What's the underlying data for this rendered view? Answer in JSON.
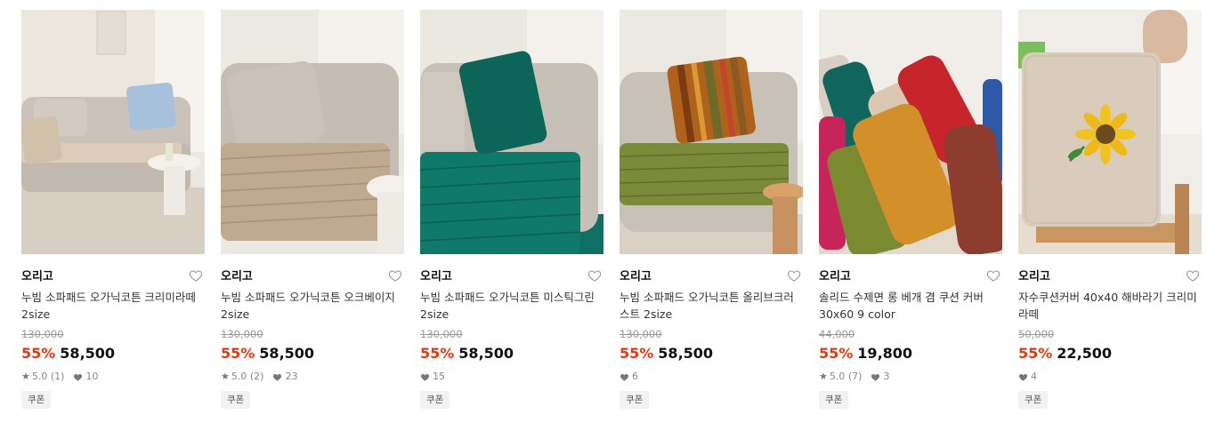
{
  "products": [
    {
      "brand": "오리고",
      "title": "누빔 소파패드 오가닉코튼 크리미라떼 2size",
      "original_price": "130,000",
      "discount_rate": "55%",
      "sale_price": "58,500",
      "rating": "5.0",
      "review_count": "(1)",
      "likes": "10",
      "coupon_label": "쿠폰",
      "thumb_colors": {
        "bg": "#e9e3da",
        "sofa": "#cfc7bd",
        "pad": "#d9c8b2",
        "pillow": "#a9c3dc"
      }
    },
    {
      "brand": "오리고",
      "title": "누빔 소파패드 오가닉코튼 오크베이지 2size",
      "original_price": "130,000",
      "discount_rate": "55%",
      "sale_price": "58,500",
      "rating": "5.0",
      "review_count": "(2)",
      "likes": "23",
      "coupon_label": "쿠폰",
      "thumb_colors": {
        "bg": "#ece8e2",
        "sofa": "#c9c0b5",
        "pad": "#bfa991",
        "pillow": "#cbbfb2"
      }
    },
    {
      "brand": "오리고",
      "title": "누빔 소파패드 오가닉코튼 미스틱그린 2size",
      "original_price": "130,000",
      "discount_rate": "55%",
      "sale_price": "58,500",
      "rating": "",
      "review_count": "",
      "likes": "15",
      "coupon_label": "쿠폰",
      "thumb_colors": {
        "bg": "#ebe7e1",
        "sofa": "#c8c1b8",
        "pad": "#0f7a6a",
        "pillow": "#0d6559"
      }
    },
    {
      "brand": "오리고",
      "title": "누빔 소파패드 오가닉코튼 올리브크러스트 2size",
      "original_price": "130,000",
      "discount_rate": "55%",
      "sale_price": "58,500",
      "rating": "",
      "review_count": "",
      "likes": "6",
      "coupon_label": "쿠폰",
      "thumb_colors": {
        "bg": "#ece8e2",
        "sofa": "#c9c2b9",
        "pad": "#7b8b3a",
        "pillow": "#b66a1e"
      }
    },
    {
      "brand": "오리고",
      "title": "솔리드 수제면 롱 베개 겸 쿠션 커버 30x60 9 color",
      "original_price": "44,000",
      "discount_rate": "55%",
      "sale_price": "19,800",
      "rating": "5.0",
      "review_count": "(7)",
      "likes": "3",
      "coupon_label": "쿠폰",
      "thumb_colors": {
        "bg": "#f1ede8",
        "sofa": "#d9cfc4",
        "pad": "#d8962a",
        "pillow": "#c42a2a"
      }
    },
    {
      "brand": "오리고",
      "title": "자수쿠션커버 40x40 해바라기 크리미라떼",
      "original_price": "50,000",
      "discount_rate": "55%",
      "sale_price": "22,500",
      "rating": "",
      "review_count": "",
      "likes": "4",
      "coupon_label": "쿠폰",
      "thumb_colors": {
        "bg": "#f0ede8",
        "sofa": "#c59a6b",
        "pad": "#ddd0bf",
        "pillow": "#f2c21f"
      }
    }
  ]
}
